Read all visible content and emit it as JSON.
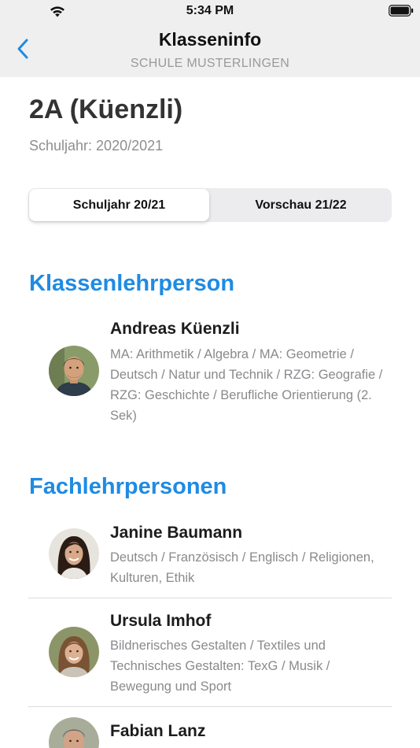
{
  "status_bar": {
    "time": "5:34 PM"
  },
  "nav": {
    "title": "Klasseninfo",
    "subtitle": "SCHULE MUSTERLINGEN",
    "back_icon": "chevron-left-icon",
    "accent": "#1f8be3"
  },
  "class_info": {
    "name": "2A (Küenzli)",
    "school_year": "Schuljahr: 2020/2021"
  },
  "segments": [
    {
      "label": "Schuljahr 20/21",
      "selected": true
    },
    {
      "label": "Vorschau 21/22",
      "selected": false
    }
  ],
  "sections": {
    "class_teacher_header": "Klassenlehrperson",
    "subject_teachers_header": "Fachlehrpersonen"
  },
  "class_teacher": {
    "name": "Andreas Küenzli",
    "subjects": "MA: Arithmetik / Algebra / MA: Geometrie / Deutsch / Natur und Technik / RZG: Geografie / RZG: Geschichte / Berufliche Orientierung (2. Sek)"
  },
  "subject_teachers": [
    {
      "name": "Janine Baumann",
      "subjects": "Deutsch / Französisch / Englisch / Religionen, Kulturen, Ethik"
    },
    {
      "name": "Ursula Imhof",
      "subjects": "Bildnerisches Gestalten / Textiles und Technisches Gestalten: TexG / Musik / Bewegung und Sport"
    },
    {
      "name": "Fabian Lanz",
      "subjects": ""
    }
  ]
}
